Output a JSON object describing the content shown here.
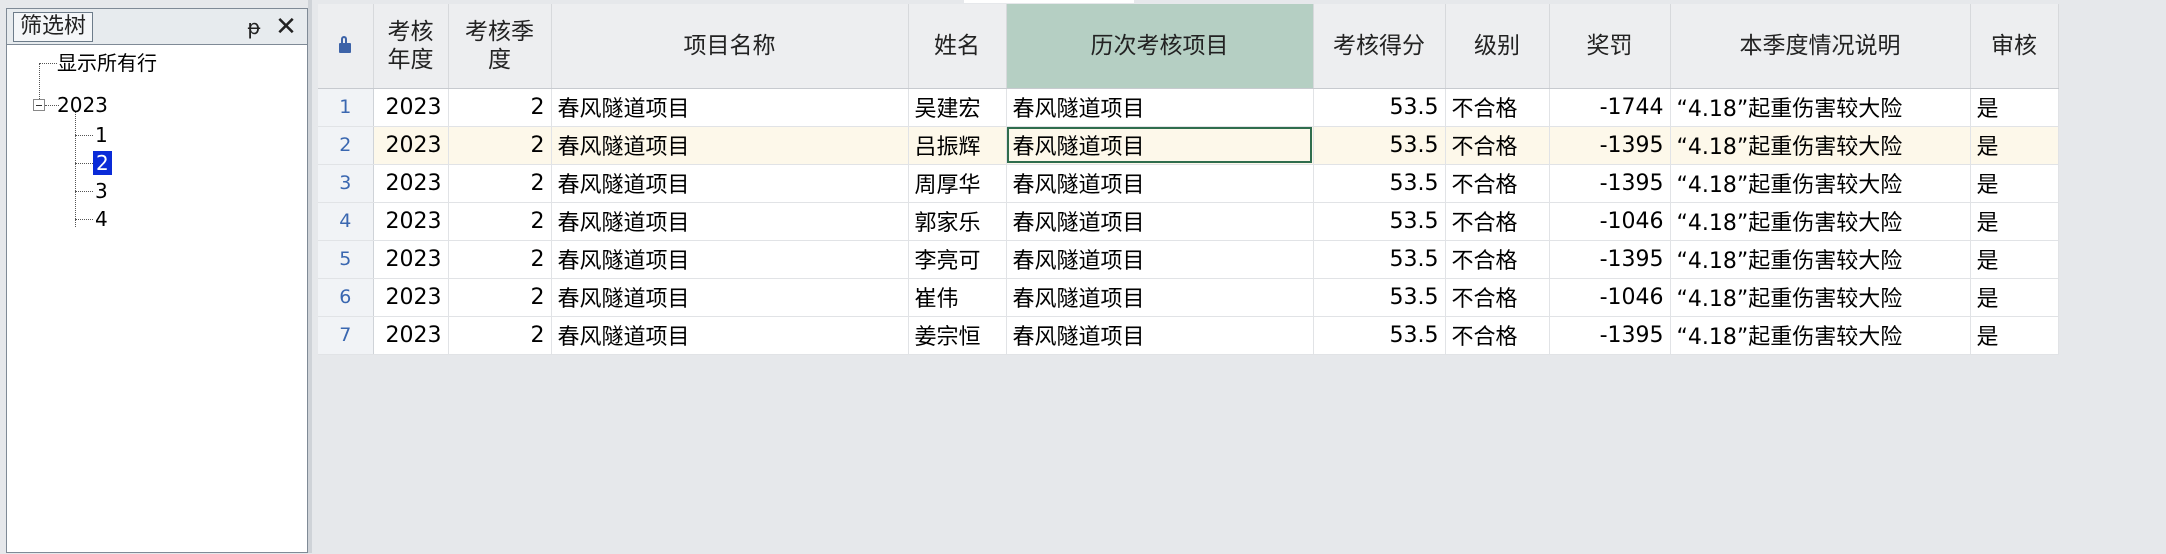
{
  "filter_panel": {
    "title": "筛选树",
    "pin_glyph": "ᵽ",
    "close_glyph": "✕",
    "show_all": "显示所有行",
    "year": "2023",
    "quarters": [
      "1",
      "2",
      "3",
      "4"
    ],
    "selected_quarter": "2"
  },
  "grid": {
    "columns": {
      "year": "考核年度",
      "quarter": "考核季度",
      "project": "项目名称",
      "name": "姓名",
      "history": "历次考核项目",
      "score": "考核得分",
      "level": "级别",
      "reward": "奖罚",
      "note": "本季度情况说明",
      "review": "审核"
    },
    "highlight_column": "history",
    "current_row": 2,
    "rows": [
      {
        "no": "1",
        "year": "2023",
        "quarter": "2",
        "project": "春风隧道项目",
        "name": "吴建宏",
        "history": "春风隧道项目",
        "score": "53.5",
        "level": "不合格",
        "reward": "-1744",
        "note": "“4.18”起重伤害较大险",
        "review": "是"
      },
      {
        "no": "2",
        "year": "2023",
        "quarter": "2",
        "project": "春风隧道项目",
        "name": "吕振辉",
        "history": "春风隧道项目",
        "score": "53.5",
        "level": "不合格",
        "reward": "-1395",
        "note": "“4.18”起重伤害较大险",
        "review": "是"
      },
      {
        "no": "3",
        "year": "2023",
        "quarter": "2",
        "project": "春风隧道项目",
        "name": "周厚华",
        "history": "春风隧道项目",
        "score": "53.5",
        "level": "不合格",
        "reward": "-1395",
        "note": "“4.18”起重伤害较大险",
        "review": "是"
      },
      {
        "no": "4",
        "year": "2023",
        "quarter": "2",
        "project": "春风隧道项目",
        "name": "郭家乐",
        "history": "春风隧道项目",
        "score": "53.5",
        "level": "不合格",
        "reward": "-1046",
        "note": "“4.18”起重伤害较大险",
        "review": "是"
      },
      {
        "no": "5",
        "year": "2023",
        "quarter": "2",
        "project": "春风隧道项目",
        "name": "李亮可",
        "history": "春风隧道项目",
        "score": "53.5",
        "level": "不合格",
        "reward": "-1395",
        "note": "“4.18”起重伤害较大险",
        "review": "是"
      },
      {
        "no": "6",
        "year": "2023",
        "quarter": "2",
        "project": "春风隧道项目",
        "name": "崔伟",
        "history": "春风隧道项目",
        "score": "53.5",
        "level": "不合格",
        "reward": "-1046",
        "note": "“4.18”起重伤害较大险",
        "review": "是"
      },
      {
        "no": "7",
        "year": "2023",
        "quarter": "2",
        "project": "春风隧道项目",
        "name": "姜宗恒",
        "history": "春风隧道项目",
        "score": "53.5",
        "level": "不合格",
        "reward": "-1395",
        "note": "“4.18”起重伤害较大险",
        "review": "是"
      }
    ]
  }
}
